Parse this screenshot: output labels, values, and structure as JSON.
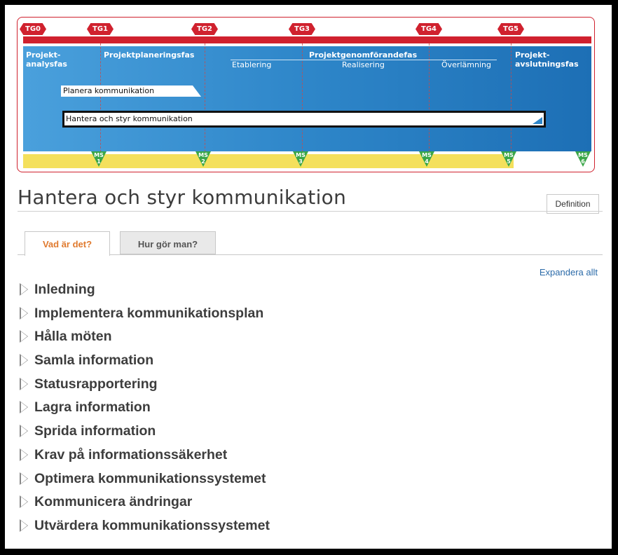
{
  "timeline": {
    "gates": [
      "TG0",
      "TG1",
      "TG2",
      "TG3",
      "TG4",
      "TG5"
    ],
    "phases": {
      "p0": "Projekt-\nanalysfas",
      "p1": "Projektplaneringsfas",
      "p2": "Projektgenomförandefas",
      "p3": "Projekt-\navslutningsfas"
    },
    "subphases": [
      "Etablering",
      "Realisering",
      "Överlämning"
    ],
    "activity_bars": [
      "Planera kommunikation",
      "Hantera och styr kommunikation"
    ],
    "milestones": [
      "MS\n1",
      "MS\n2",
      "MS\n3",
      "MS\n4",
      "MS\n5",
      "MS\n6"
    ]
  },
  "page": {
    "title": "Hantera och styr kommunikation",
    "definition_button": "Definition"
  },
  "tabs": [
    "Vad är det?",
    "Hur gör man?"
  ],
  "expand_all": "Expandera allt",
  "sections": [
    "Inledning",
    "Implementera kommunikationsplan",
    "Hålla möten",
    "Samla information",
    "Statusrapportering",
    "Lagra information",
    "Sprida information",
    "Krav på informationssäkerhet",
    "Optimera kommunikationssystemet",
    "Kommunicera ändringar",
    "Utvärdera kommunikationssystemet"
  ],
  "colors": {
    "gate_red": "#d0212e",
    "phase_blue": "#2e86c9",
    "milestone_green": "#3aa648",
    "track_yellow": "#f4e05c",
    "active_tab": "#e07a2e",
    "link_blue": "#2a6aa8"
  }
}
